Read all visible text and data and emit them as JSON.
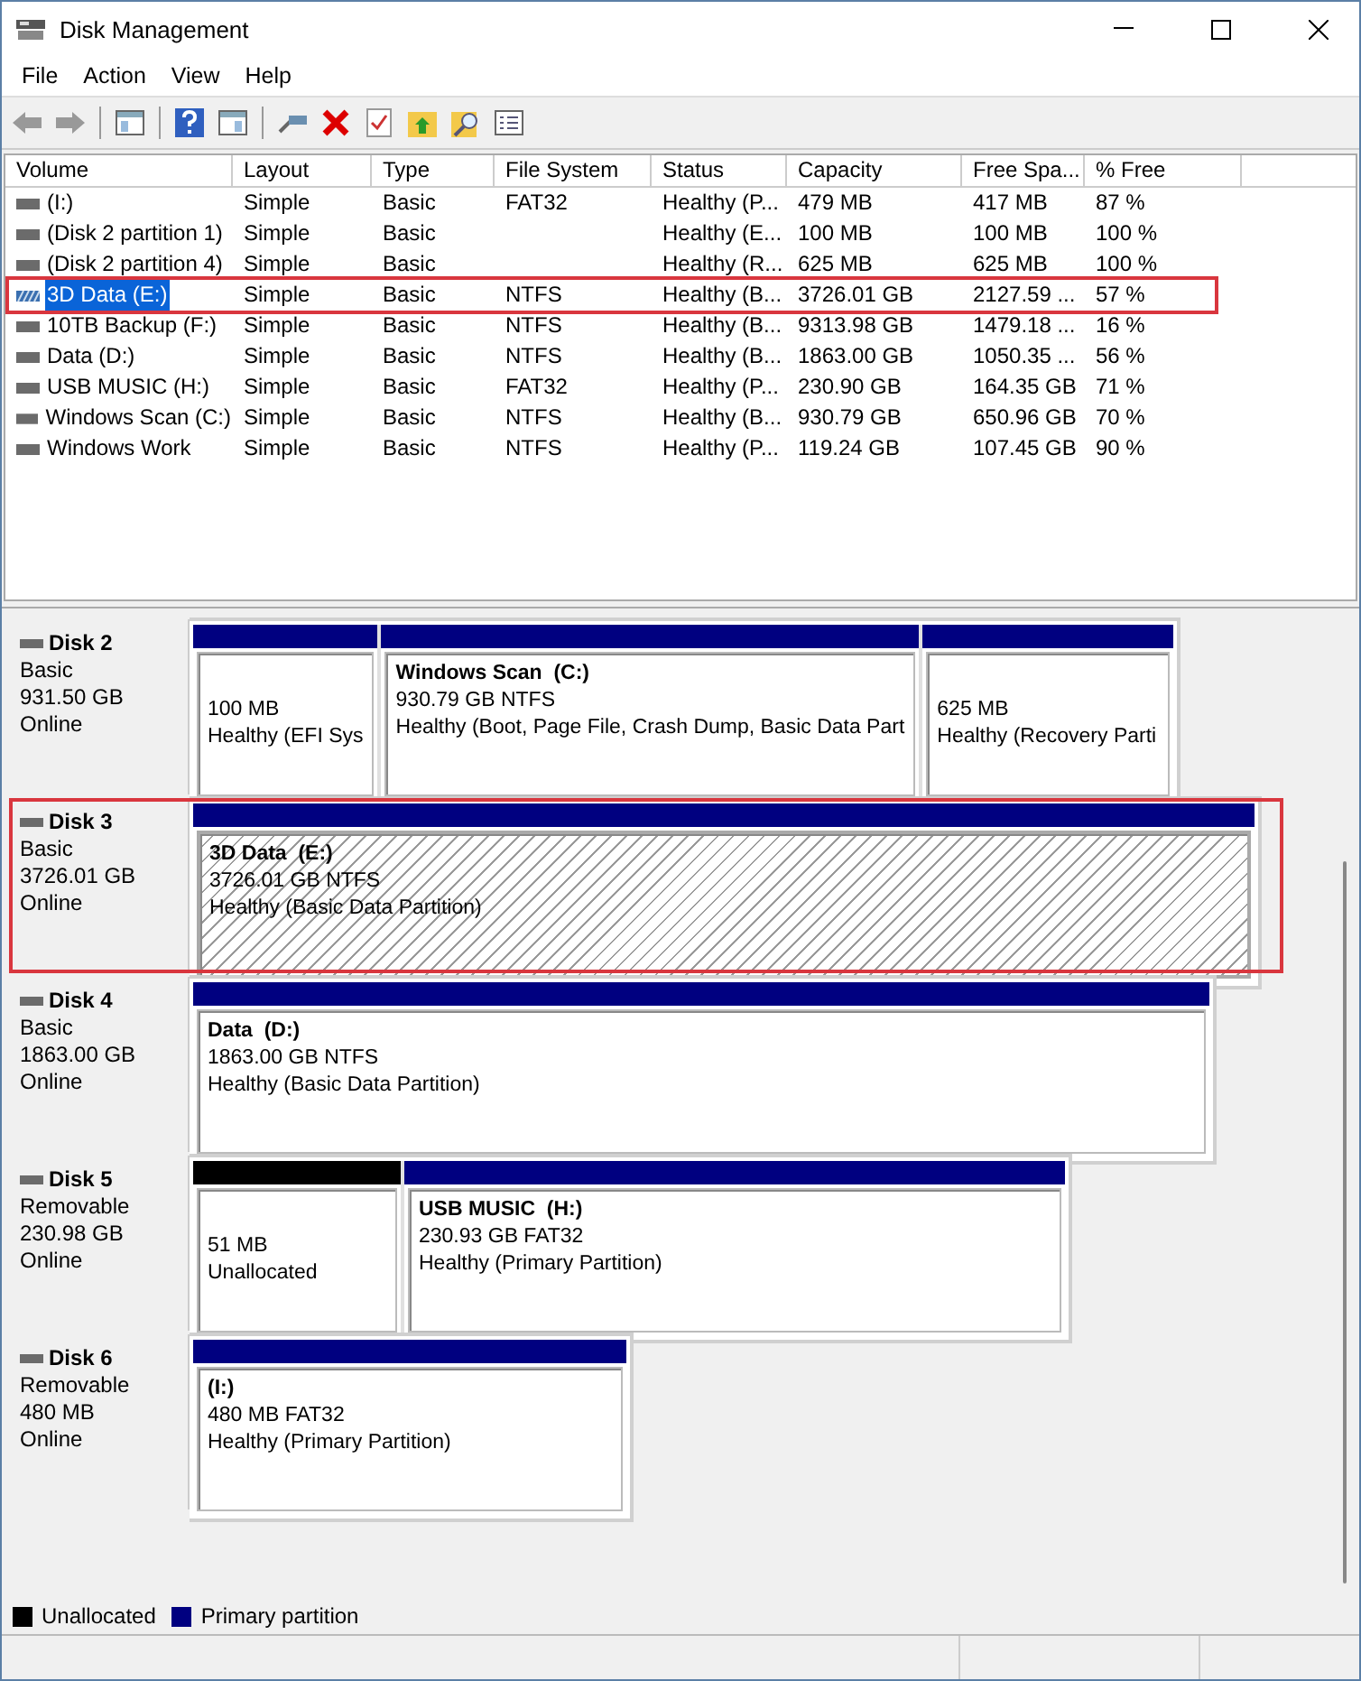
{
  "window": {
    "title": "Disk Management"
  },
  "menu": [
    "File",
    "Action",
    "View",
    "Help"
  ],
  "volumes": {
    "columns": [
      "Volume",
      "Layout",
      "Type",
      "File System",
      "Status",
      "Capacity",
      "Free Spa...",
      "% Free"
    ],
    "rows": [
      {
        "cells": [
          "(I:)",
          "Simple",
          "Basic",
          "FAT32",
          "Healthy (P...",
          "479 MB",
          "417 MB",
          "87 %"
        ],
        "selected": false,
        "highlighted": false
      },
      {
        "cells": [
          "(Disk 2 partition 1)",
          "Simple",
          "Basic",
          "",
          "Healthy (E...",
          "100 MB",
          "100 MB",
          "100 %"
        ],
        "selected": false,
        "highlighted": false
      },
      {
        "cells": [
          "(Disk 2 partition 4)",
          "Simple",
          "Basic",
          "",
          "Healthy (R...",
          "625 MB",
          "625 MB",
          "100 %"
        ],
        "selected": false,
        "highlighted": false
      },
      {
        "cells": [
          "3D Data (E:)",
          "Simple",
          "Basic",
          "NTFS",
          "Healthy (B...",
          "3726.01 GB",
          "2127.59 ...",
          "57 %"
        ],
        "selected": true,
        "highlighted": true
      },
      {
        "cells": [
          "10TB Backup (F:)",
          "Simple",
          "Basic",
          "NTFS",
          "Healthy (B...",
          "9313.98 GB",
          "1479.18 ...",
          "16 %"
        ],
        "selected": false,
        "highlighted": false
      },
      {
        "cells": [
          "Data (D:)",
          "Simple",
          "Basic",
          "NTFS",
          "Healthy (B...",
          "1863.00 GB",
          "1050.35 ...",
          "56 %"
        ],
        "selected": false,
        "highlighted": false
      },
      {
        "cells": [
          "USB MUSIC (H:)",
          "Simple",
          "Basic",
          "FAT32",
          "Healthy (P...",
          "230.90 GB",
          "164.35 GB",
          "71 %"
        ],
        "selected": false,
        "highlighted": false
      },
      {
        "cells": [
          "Windows Scan (C:)",
          "Simple",
          "Basic",
          "NTFS",
          "Healthy (B...",
          "930.79 GB",
          "650.96 GB",
          "70 %"
        ],
        "selected": false,
        "highlighted": false
      },
      {
        "cells": [
          "Windows Work",
          "Simple",
          "Basic",
          "NTFS",
          "Healthy (P...",
          "119.24 GB",
          "107.45 GB",
          "90 %"
        ],
        "selected": false,
        "highlighted": false
      }
    ]
  },
  "disks": [
    {
      "name": "Disk 2",
      "type": "Basic",
      "size": "931.50 GB",
      "state": "Online",
      "highlighted": false,
      "partitions": [
        {
          "kind": "primary",
          "selected": false,
          "lines": [
            "100 MB",
            "Healthy (EFI Sys"
          ]
        },
        {
          "kind": "primary",
          "selected": false,
          "name": "Windows Scan  (C:)",
          "lines": [
            "930.79 GB NTFS",
            "Healthy (Boot, Page File, Crash Dump, Basic Data Part"
          ]
        },
        {
          "kind": "primary",
          "selected": false,
          "lines": [
            "625 MB",
            "Healthy (Recovery Parti"
          ]
        }
      ]
    },
    {
      "name": "Disk 3",
      "type": "Basic",
      "size": "3726.01 GB",
      "state": "Online",
      "highlighted": true,
      "partitions": [
        {
          "kind": "primary",
          "selected": true,
          "name": "3D Data  (E:)",
          "lines": [
            "3726.01 GB NTFS",
            "Healthy (Basic Data Partition)"
          ]
        }
      ]
    },
    {
      "name": "Disk 4",
      "type": "Basic",
      "size": "1863.00 GB",
      "state": "Online",
      "highlighted": false,
      "partitions": [
        {
          "kind": "primary",
          "selected": false,
          "name": "Data  (D:)",
          "lines": [
            "1863.00 GB NTFS",
            "Healthy (Basic Data Partition)"
          ]
        }
      ]
    },
    {
      "name": "Disk 5",
      "type": "Removable",
      "size": "230.98 GB",
      "state": "Online",
      "highlighted": false,
      "partitions": [
        {
          "kind": "unallocated",
          "selected": false,
          "lines": [
            "51 MB",
            "Unallocated"
          ]
        },
        {
          "kind": "primary",
          "selected": false,
          "name": "USB MUSIC  (H:)",
          "lines": [
            "230.93 GB FAT32",
            "Healthy (Primary Partition)"
          ]
        }
      ]
    },
    {
      "name": "Disk 6",
      "type": "Removable",
      "size": "480 MB",
      "state": "Online",
      "highlighted": false,
      "partitions": [
        {
          "kind": "primary",
          "selected": false,
          "name": "(I:)",
          "lines": [
            "480 MB FAT32",
            "Healthy (Primary Partition)"
          ]
        }
      ]
    }
  ],
  "legend": [
    {
      "label": "Unallocated",
      "color": "#000000"
    },
    {
      "label": "Primary partition",
      "color": "#000080"
    }
  ]
}
